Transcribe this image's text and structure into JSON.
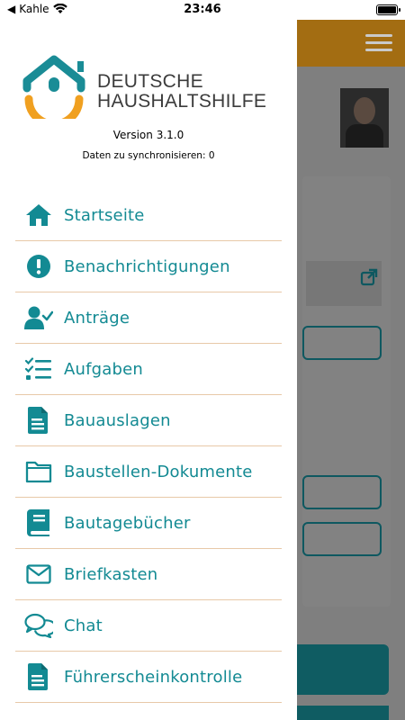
{
  "status_bar": {
    "carrier": "Kahle",
    "time": "23:46"
  },
  "drawer": {
    "brand_line1": "DEUTSCHE",
    "brand_line2": "HAUSHALTSHILFE",
    "version": "Version 3.1.0",
    "sync_status": "Daten zu synchronisieren: 0",
    "menu": [
      {
        "label": "Startseite",
        "icon": "home-icon"
      },
      {
        "label": "Benachrichtigungen",
        "icon": "alert-circle-icon"
      },
      {
        "label": "Anträge",
        "icon": "user-check-icon"
      },
      {
        "label": "Aufgaben",
        "icon": "task-list-icon"
      },
      {
        "label": "Bauauslagen",
        "icon": "document-icon"
      },
      {
        "label": "Baustellen-Dokumente",
        "icon": "folder-icon"
      },
      {
        "label": "Bautagebücher",
        "icon": "book-icon"
      },
      {
        "label": "Briefkasten",
        "icon": "envelope-icon"
      },
      {
        "label": "Chat",
        "icon": "chat-icon"
      },
      {
        "label": "Führerscheinkontrolle",
        "icon": "document-icon"
      }
    ]
  },
  "colors": {
    "accent": "#138a93",
    "divider": "#e8c9a8",
    "logo_teal": "#1a8c96",
    "logo_orange": "#f0a020",
    "header_bg": "#a36d12"
  }
}
